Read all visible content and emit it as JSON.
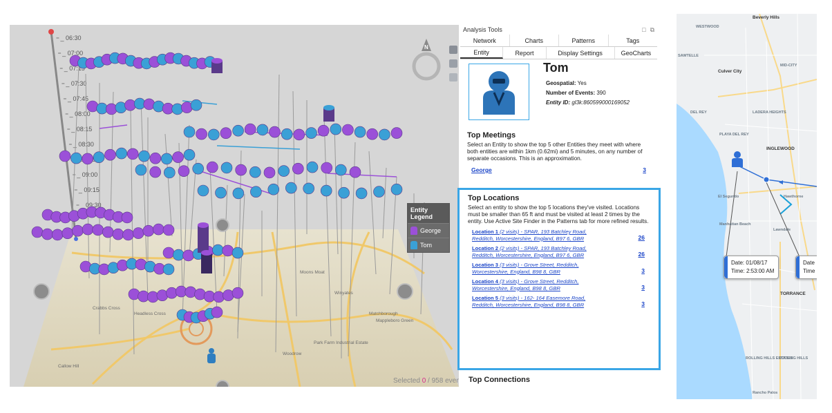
{
  "timeline": {
    "labels": [
      "06:30",
      "07:00",
      "07:15",
      "07:30",
      "07:45",
      "08:00",
      "08:15",
      "08:30",
      "08:45",
      "09:00",
      "09:15",
      "09:30"
    ]
  },
  "colors": {
    "george": "#9b50d8",
    "tom": "#3aa0d6",
    "accent": "#3aa6e6",
    "link": "#1a44c8",
    "selected": "#d62b8c"
  },
  "legend": {
    "title": "Entity Legend",
    "items": [
      {
        "label": "George",
        "color": "#9b50d8"
      },
      {
        "label": "Tom",
        "color": "#3aa0d6"
      }
    ]
  },
  "map3d": {
    "place_labels": [
      "Headless Cross",
      "Woodrow",
      "Park Farm Industrial Estate",
      "Callow Hill",
      "Crabbs Cross",
      "Matchborough",
      "Moons Moat",
      "Winyates",
      "Mappleboro Green"
    ]
  },
  "status": {
    "prefix": "Selected",
    "selected": "0",
    "sep": "/",
    "total": "958 events"
  },
  "panel": {
    "title": "Analysis Tools",
    "tabs_row1": [
      "Network",
      "Charts",
      "Patterns",
      "Tags"
    ],
    "tabs_row2": [
      "Entity",
      "Report",
      "Display Settings",
      "GeoCharts"
    ],
    "active_tab": "Entity"
  },
  "entity": {
    "name": "Tom",
    "geospatial_label": "Geospatial:",
    "geospatial_value": "Yes",
    "events_label": "Number of Events:",
    "events_value": "390",
    "id_label": "Entity ID:",
    "id_value": "gl3k:860599000169052"
  },
  "top_meetings": {
    "title": "Top Meetings",
    "description": "Select an Entity to show the top 5 other Entities they meet with where both entities are within 1km (0.62mi) and 5 minutes, on any number of separate occasions. This is an approximation.",
    "items": [
      {
        "name": "George",
        "count": "3"
      }
    ]
  },
  "top_locations": {
    "title": "Top Locations",
    "description": "Select an entity to show the top 5 locations they've visited. Locations must be smaller than 65 ft and must be visited at least 2 times by the entity. Use Active Site Finder in the Patterns tab for more refined results.",
    "items": [
      {
        "name": "Location 1",
        "visits": "(2 visits)",
        "address": "- SPAR, 193 Batchley Road, Redditch, Worcestershire, England, B97 6, GBR",
        "count": "26"
      },
      {
        "name": "Location 2",
        "visits": "(2 visits)",
        "address": "- SPAR, 193 Batchley Road, Redditch, Worcestershire, England, B97 6, GBR",
        "count": "26"
      },
      {
        "name": "Location 3",
        "visits": "(3 visits)",
        "address": "- Grove Street, Redditch, Worcestershire, England, B98 8, GBR",
        "count": "3"
      },
      {
        "name": "Location 4",
        "visits": "(3 visits)",
        "address": "- Grove Street, Redditch, Worcestershire, England, B98 8, GBR",
        "count": "3"
      },
      {
        "name": "Location 5",
        "visits": "(3 visits)",
        "address": "- 162- 164 Easemore Road, Redditch, Worcestershire, England, B98 8, GBR",
        "count": "3"
      }
    ]
  },
  "top_connections": {
    "title": "Top Connections"
  },
  "map2d": {
    "labels": [
      "Beverly Hills",
      "WESTWOOD",
      "SAWTELLE",
      "MID-CITY",
      "Culver City",
      "DEL REY",
      "LADERA HEIGHTS",
      "PLAYA DEL REY",
      "INGLEWOOD",
      "El Segundo",
      "Hawthorne",
      "Manhattan Beach",
      "Lawndale",
      "TORRANCE",
      "Rancho Palos",
      "ROLLING HILLS ESTATES",
      "ROLLING HILLS"
    ],
    "tooltips": [
      {
        "date_label": "Date:",
        "date": "01/08/17",
        "time_label": "Time:",
        "time": "2:53:00 AM"
      },
      {
        "date_label": "Date",
        "time_label": "Time"
      }
    ]
  }
}
